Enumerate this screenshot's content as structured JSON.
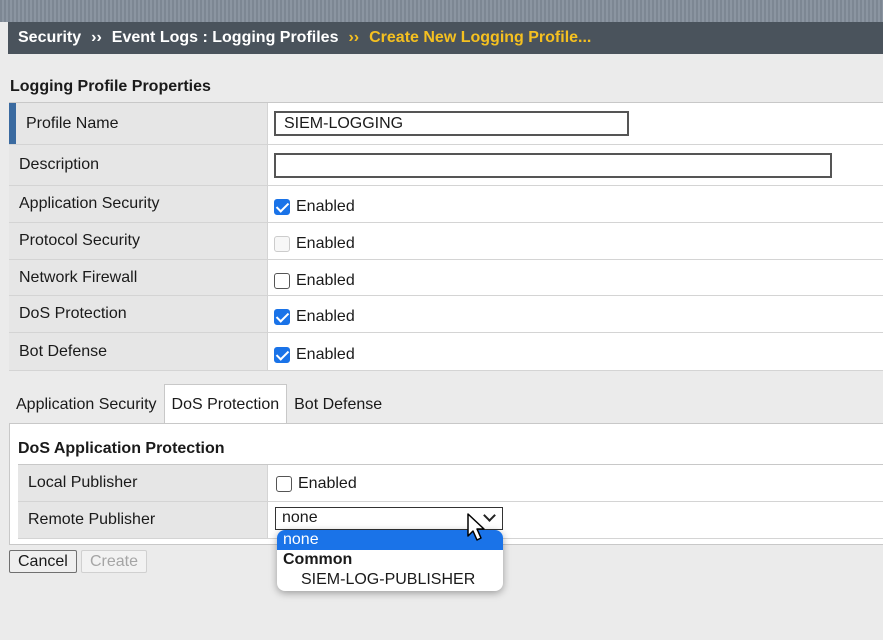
{
  "breadcrumb": {
    "level1": "Security",
    "level2": "Event Logs : Logging Profiles",
    "current": "Create New Logging Profile...",
    "separator": "››"
  },
  "section": {
    "title": "Logging Profile Properties"
  },
  "profile_name": {
    "label": "Profile Name",
    "value": "SIEM-LOGGING"
  },
  "description": {
    "label": "Description",
    "value": ""
  },
  "rows": [
    {
      "label": "Application Security",
      "checkbox_label": "Enabled",
      "checked": true,
      "disabled": false
    },
    {
      "label": "Protocol Security",
      "checkbox_label": "Enabled",
      "checked": false,
      "disabled": true
    },
    {
      "label": "Network Firewall",
      "checkbox_label": "Enabled",
      "checked": false,
      "disabled": false
    },
    {
      "label": "DoS Protection",
      "checkbox_label": "Enabled",
      "checked": true,
      "disabled": false
    },
    {
      "label": "Bot Defense",
      "checkbox_label": "Enabled",
      "checked": true,
      "disabled": false
    }
  ],
  "tabs": [
    {
      "label": "Application Security",
      "active": false
    },
    {
      "label": "DoS Protection",
      "active": true
    },
    {
      "label": "Bot Defense",
      "active": false
    }
  ],
  "dos": {
    "title": "DoS Application Protection",
    "local_publisher": {
      "label": "Local Publisher",
      "checkbox_label": "Enabled",
      "checked": false
    },
    "remote_publisher": {
      "label": "Remote Publisher",
      "selected": "none",
      "options": [
        {
          "text": "none",
          "kind": "option",
          "selected": true
        },
        {
          "text": "Common",
          "kind": "group"
        },
        {
          "text": "SIEM-LOG-PUBLISHER",
          "kind": "option"
        }
      ]
    }
  },
  "buttons": {
    "cancel": "Cancel",
    "create": "Create"
  },
  "colors": {
    "accent": "#1a73e8",
    "breadcrumb_bg": "#4a535c",
    "breadcrumb_current": "#f5c020"
  }
}
